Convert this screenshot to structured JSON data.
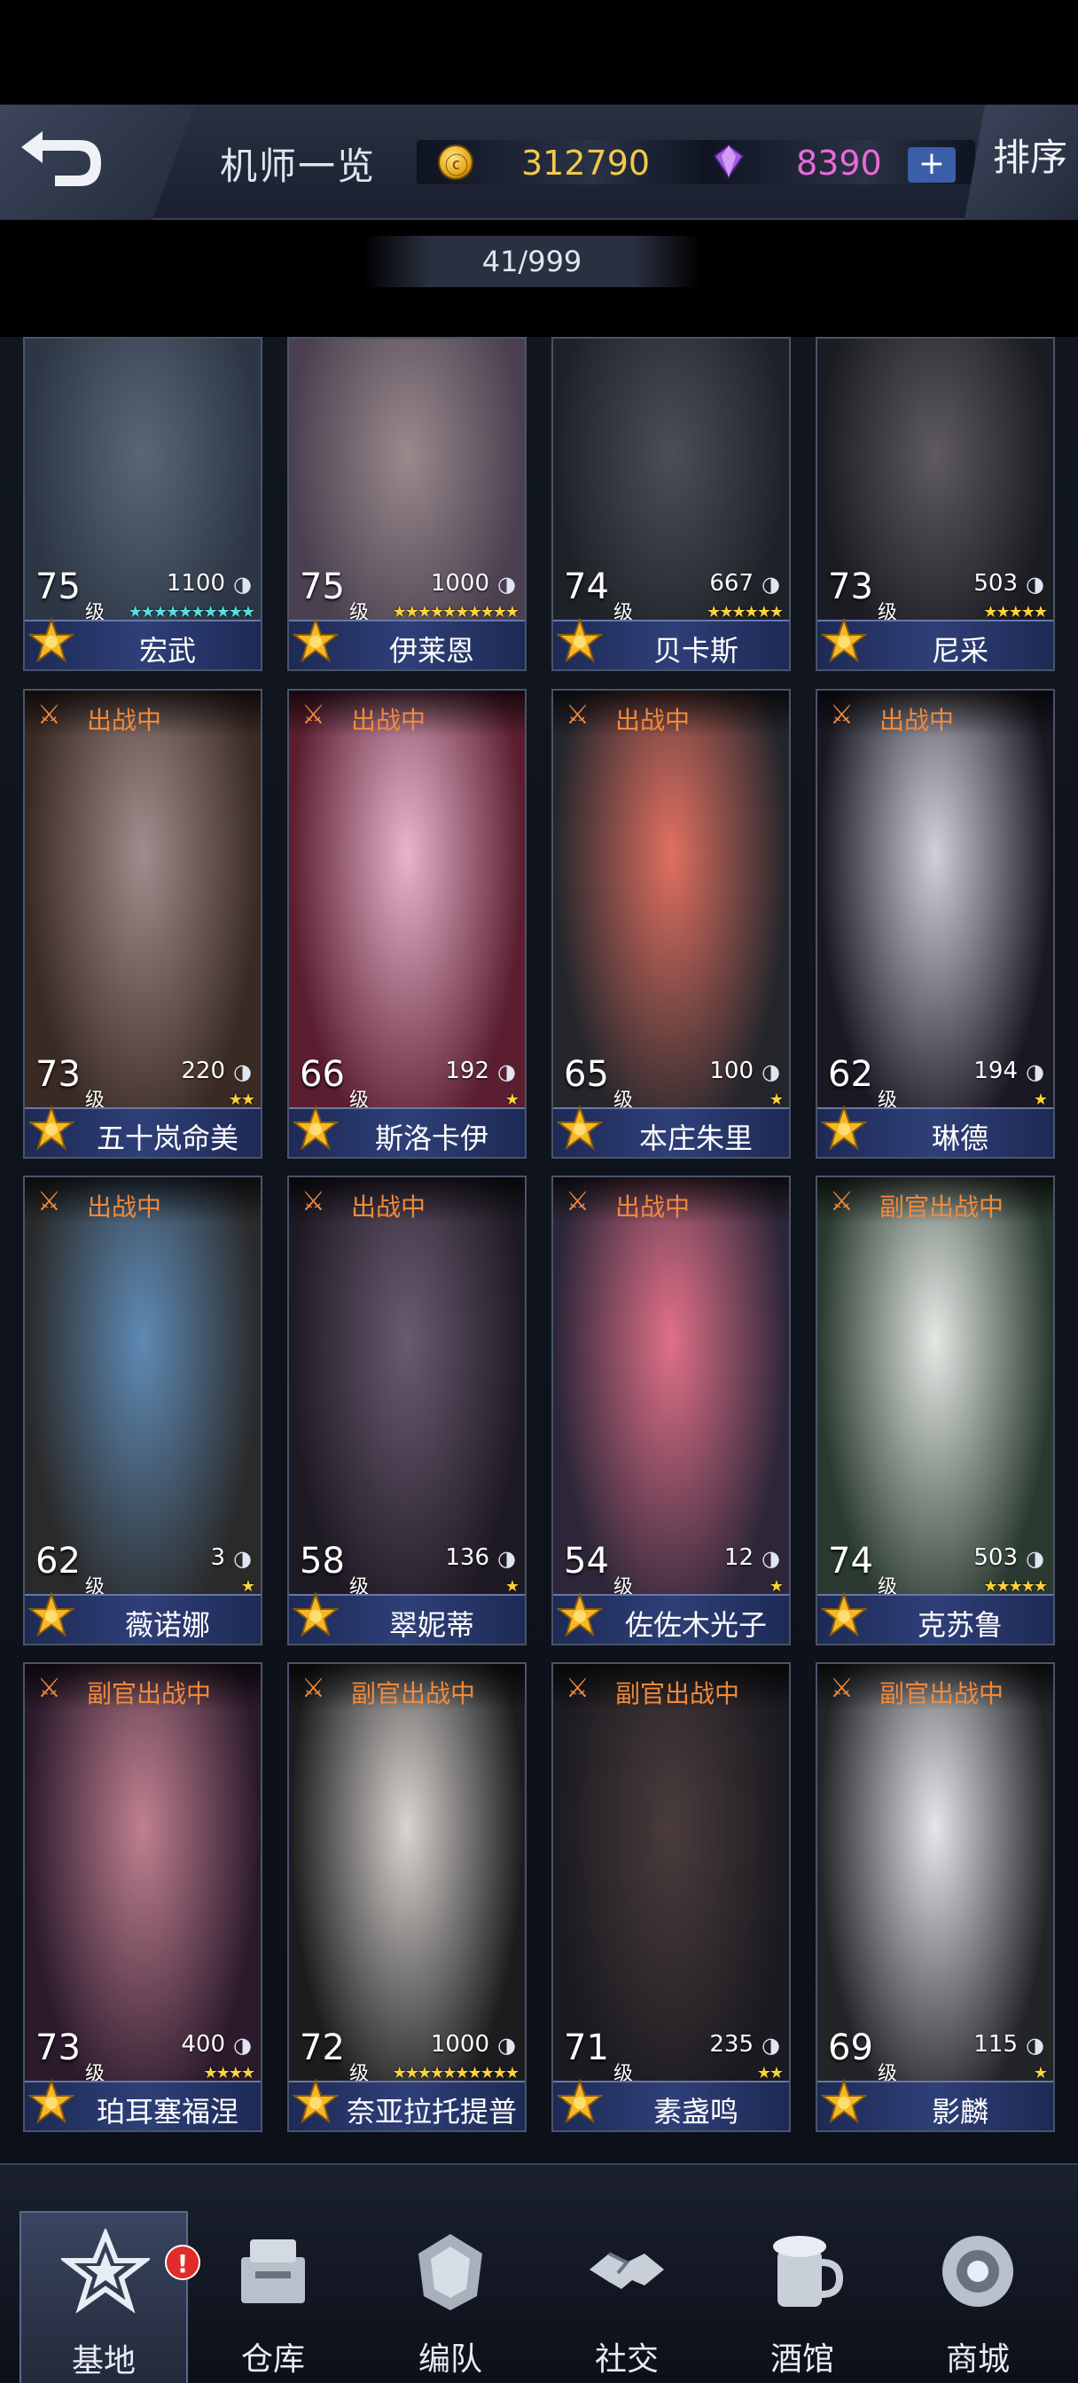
{
  "header": {
    "title": "机师一览",
    "coins": "312790",
    "gems": "8390",
    "plus": "+",
    "sort": "排序"
  },
  "counter": "41/999",
  "level_unit": "级",
  "cards": [
    {
      "name": "宏武",
      "level": "75",
      "power": "1100",
      "stars": "★★★★★★★★★★",
      "deploy": "",
      "star_color": "cyan",
      "colors": [
        "#2c3644",
        "#5a6678"
      ]
    },
    {
      "name": "伊莱恩",
      "level": "75",
      "power": "1000",
      "stars": "★★★★★★★★★★",
      "deploy": "",
      "star_color": "gold",
      "colors": [
        "#4a4050",
        "#9a8a8c"
      ]
    },
    {
      "name": "贝卡斯",
      "level": "74",
      "power": "667",
      "stars": "★★★★★★",
      "deploy": "",
      "star_color": "gold",
      "colors": [
        "#1e2228",
        "#4a4e58"
      ]
    },
    {
      "name": "尼采",
      "level": "73",
      "power": "503",
      "stars": "★★★★★",
      "deploy": "",
      "star_color": "gold",
      "colors": [
        "#1a1c22",
        "#5e5a60"
      ]
    },
    {
      "name": "五十岚命美",
      "level": "73",
      "power": "220",
      "stars": "★★",
      "deploy": "出战中",
      "star_color": "gold",
      "colors": [
        "#3a2a24",
        "#a08c8c"
      ]
    },
    {
      "name": "斯洛卡伊",
      "level": "66",
      "power": "192",
      "stars": "★",
      "deploy": "出战中",
      "star_color": "gold",
      "colors": [
        "#5a1e30",
        "#e8b4cc"
      ]
    },
    {
      "name": "本庄朱里",
      "level": "65",
      "power": "100",
      "stars": "★",
      "deploy": "出战中",
      "star_color": "gold",
      "colors": [
        "#24262c",
        "#e07060"
      ]
    },
    {
      "name": "琳德",
      "level": "62",
      "power": "194",
      "stars": "★",
      "deploy": "出战中",
      "star_color": "gold",
      "colors": [
        "#1a1822",
        "#d0d0dc"
      ]
    },
    {
      "name": "薇诺娜",
      "level": "62",
      "power": "3",
      "stars": "★",
      "deploy": "出战中",
      "star_color": "gold",
      "colors": [
        "#2a2a2a",
        "#5e8ab4"
      ]
    },
    {
      "name": "翠妮蒂",
      "level": "58",
      "power": "136",
      "stars": "★",
      "deploy": "出战中",
      "star_color": "gold",
      "colors": [
        "#1e1a24",
        "#6a5a70"
      ]
    },
    {
      "name": "佐佐木光子",
      "level": "54",
      "power": "12",
      "stars": "★",
      "deploy": "出战中",
      "star_color": "gold",
      "colors": [
        "#2c2638",
        "#e07088"
      ]
    },
    {
      "name": "克苏鲁",
      "level": "74",
      "power": "503",
      "stars": "★★★★★",
      "deploy": "副官出战中",
      "star_color": "gold",
      "colors": [
        "#2a3a30",
        "#e4e8e4"
      ]
    },
    {
      "name": "珀耳塞福涅",
      "level": "73",
      "power": "400",
      "stars": "★★★★",
      "deploy": "副官出战中",
      "star_color": "gold",
      "colors": [
        "#2a1a2c",
        "#c08090"
      ]
    },
    {
      "name": "奈亚拉托提普",
      "level": "72",
      "power": "1000",
      "stars": "★★★★★★★★★★",
      "deploy": "副官出战中",
      "star_color": "gold",
      "colors": [
        "#1c1c1e",
        "#d8d4d0"
      ]
    },
    {
      "name": "素盏鸣",
      "level": "71",
      "power": "235",
      "stars": "★★",
      "deploy": "副官出战中",
      "star_color": "gold",
      "colors": [
        "#1a1a20",
        "#4a3c3c"
      ]
    },
    {
      "name": "影麟",
      "level": "69",
      "power": "115",
      "stars": "★",
      "deploy": "副官出战中",
      "star_color": "gold",
      "colors": [
        "#222428",
        "#e4e6ea"
      ]
    }
  ],
  "nav": [
    {
      "label": "基地",
      "icon": "base-icon",
      "active": true,
      "badge": "!"
    },
    {
      "label": "仓库",
      "icon": "warehouse-icon",
      "active": false
    },
    {
      "label": "编队",
      "icon": "formation-icon",
      "active": false
    },
    {
      "label": "社交",
      "icon": "social-icon",
      "active": false
    },
    {
      "label": "酒馆",
      "icon": "tavern-icon",
      "active": false
    },
    {
      "label": "商城",
      "icon": "shop-icon",
      "active": false
    }
  ]
}
